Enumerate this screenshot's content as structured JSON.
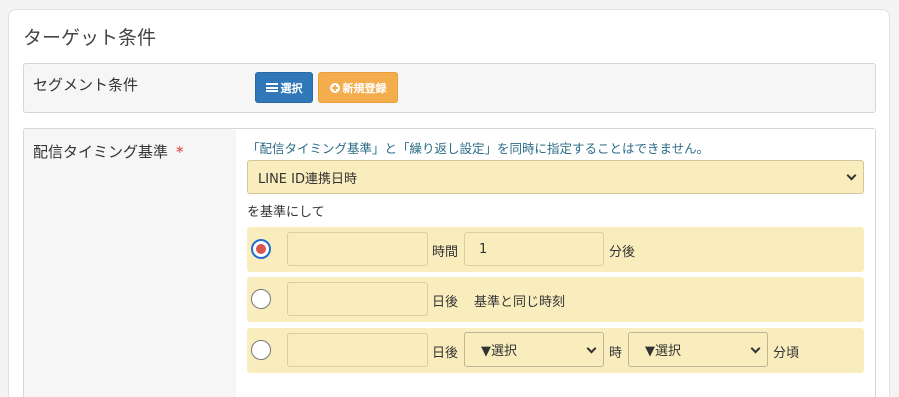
{
  "card": {
    "title": "ターゲット条件"
  },
  "segment": {
    "label": "セグメント条件",
    "select_button": "選択",
    "new_button": "新規登録"
  },
  "timing": {
    "label": "配信タイミング基準",
    "required_mark": "*",
    "notice": "「配信タイミング基準」と「繰り返し設定」を同時に指定することはできません。",
    "base_select_value": "LINE ID連携日時",
    "base_suffix": "を基準にして",
    "option1": {
      "selected": true,
      "input1_value": "",
      "unit1": "時間",
      "input2_value": "1",
      "unit2": "分後"
    },
    "option2": {
      "selected": false,
      "input_value": "",
      "unit": "日後",
      "desc": "基準と同じ時刻"
    },
    "option3": {
      "selected": false,
      "input_value": "",
      "unit": "日後",
      "hour_select": "▼選択",
      "hour_unit": "時",
      "minute_select": "▼選択",
      "minute_unit": "分頃"
    }
  },
  "colors": {
    "primary_button": "#3078b8",
    "warning_button": "#f3ad4d",
    "field_bg": "#f9edbe",
    "notice_text": "#2a6c86",
    "required": "#e0392b"
  },
  "icons": {
    "select_button_icon": "list-icon",
    "new_button_icon": "plus-circle-icon",
    "dropdown_icon": "chevron-down-icon"
  }
}
